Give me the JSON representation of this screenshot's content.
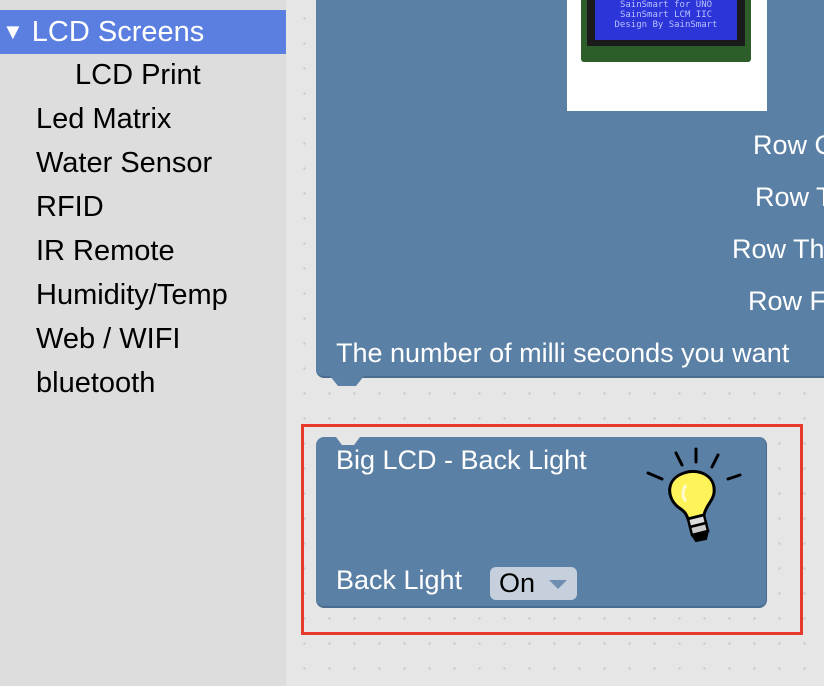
{
  "sidebar": {
    "items": [
      {
        "label": "LCD Screens",
        "selected": true,
        "expanded": true,
        "icon": "triangle-down-icon"
      },
      {
        "label": "LCD Print"
      },
      {
        "label": "Led Matrix"
      },
      {
        "label": "Water Sensor"
      },
      {
        "label": "RFID"
      },
      {
        "label": "IR Remote"
      },
      {
        "label": "Humidity/Temp"
      },
      {
        "label": "Web / WIFI"
      },
      {
        "label": "bluetooth"
      }
    ],
    "expand_glyph": "▼"
  },
  "upper_block": {
    "lcd_image_lines": [
      "SainSmart for UNO",
      "SainSmart LCM IIC",
      "Design By SainSmart"
    ],
    "rows": [
      "Row O",
      "Row T",
      "Row Th",
      "Row F"
    ],
    "delay_label": "The number of milli seconds you want"
  },
  "backlight_block": {
    "title": "Big LCD - Back Light",
    "field_label": "Back Light",
    "dropdown_value": "On",
    "icon": "lightbulb-icon"
  },
  "colors": {
    "block": "#5b80a5",
    "selected_category": "#5b7fe0",
    "highlight": "#e8392e",
    "dropdown": "#c5d0dc"
  }
}
